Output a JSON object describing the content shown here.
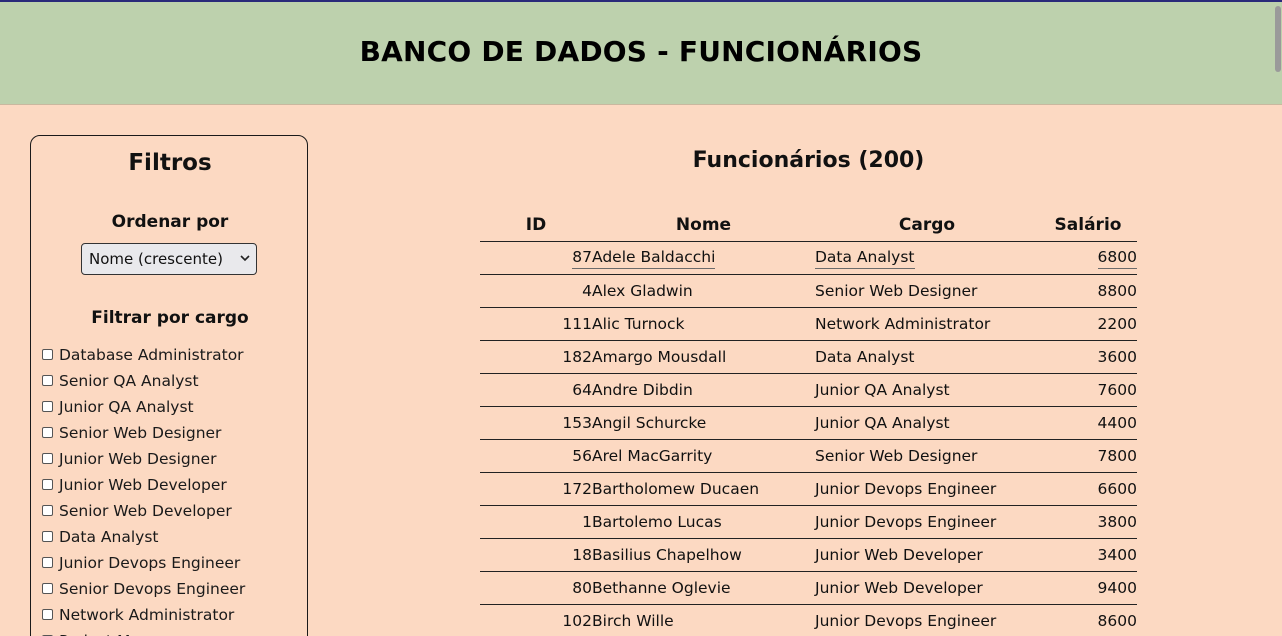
{
  "header": {
    "title": "BANCO DE DADOS - FUNCIONÁRIOS"
  },
  "filters": {
    "title": "Filtros",
    "sort_label": "Ordenar por",
    "sort_selected": "Nome (crescente)",
    "cargo_label": "Filtrar por cargo",
    "cargos": [
      "Database Administrator",
      "Senior QA Analyst",
      "Junior QA Analyst",
      "Senior Web Designer",
      "Junior Web Designer",
      "Junior Web Developer",
      "Senior Web Developer",
      "Data Analyst",
      "Junior Devops Engineer",
      "Senior Devops Engineer",
      "Network Administrator",
      "Project Manager"
    ]
  },
  "main": {
    "title": "Funcionários (200)",
    "columns": [
      "ID",
      "Nome",
      "Cargo",
      "Salário"
    ],
    "rows": [
      {
        "id": "87",
        "nome": "Adele Baldacchi",
        "cargo": "Data Analyst",
        "salario": "6800"
      },
      {
        "id": "4",
        "nome": "Alex Gladwin",
        "cargo": "Senior Web Designer",
        "salario": "8800"
      },
      {
        "id": "111",
        "nome": "Alic Turnock",
        "cargo": "Network Administrator",
        "salario": "2200"
      },
      {
        "id": "182",
        "nome": "Amargo Mousdall",
        "cargo": "Data Analyst",
        "salario": "3600"
      },
      {
        "id": "64",
        "nome": "Andre Dibdin",
        "cargo": "Junior QA Analyst",
        "salario": "7600"
      },
      {
        "id": "153",
        "nome": "Angil Schurcke",
        "cargo": "Junior QA Analyst",
        "salario": "4400"
      },
      {
        "id": "56",
        "nome": "Arel MacGarrity",
        "cargo": "Senior Web Designer",
        "salario": "7800"
      },
      {
        "id": "172",
        "nome": "Bartholomew Ducaen",
        "cargo": "Junior Devops Engineer",
        "salario": "6600"
      },
      {
        "id": "1",
        "nome": "Bartolemo Lucas",
        "cargo": "Junior Devops Engineer",
        "salario": "3800"
      },
      {
        "id": "18",
        "nome": "Basilius Chapelhow",
        "cargo": "Junior Web Developer",
        "salario": "3400"
      },
      {
        "id": "80",
        "nome": "Bethanne Oglevie",
        "cargo": "Junior Web Developer",
        "salario": "9400"
      },
      {
        "id": "102",
        "nome": "Birch Wille",
        "cargo": "Junior Devops Engineer",
        "salario": "8600"
      }
    ]
  },
  "colors": {
    "background": "#fcd9c2",
    "header_bg": "#bdd1ad"
  }
}
